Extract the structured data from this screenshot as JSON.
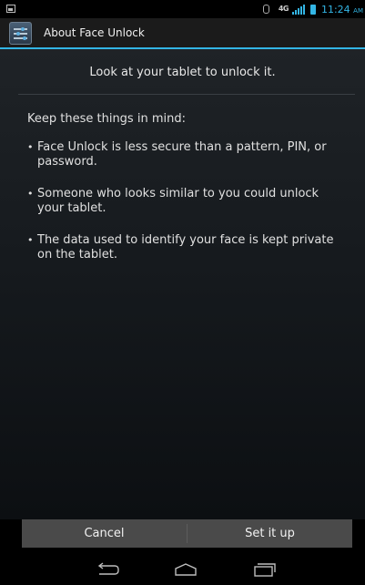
{
  "status_bar": {
    "network_label": "4G",
    "time": "11:24",
    "ampm": "AM",
    "left_icon": "picture-notification-icon",
    "accent_color": "#33b5e5"
  },
  "action_bar": {
    "title": "About Face Unlock",
    "icon": "settings-app-icon"
  },
  "content": {
    "headline": "Look at your tablet to unlock it.",
    "intro": "Keep these things in mind:",
    "bullets": [
      "Face Unlock is less secure than a pattern, PIN, or password.",
      "Someone who looks similar to you could unlock your tablet.",
      "The data used to identify your face is kept private on the tablet."
    ]
  },
  "buttons": {
    "cancel": "Cancel",
    "setup": "Set it up"
  },
  "nav_bar": {
    "back_icon": "back-icon",
    "home_icon": "home-icon",
    "recents_icon": "recent-apps-icon"
  }
}
